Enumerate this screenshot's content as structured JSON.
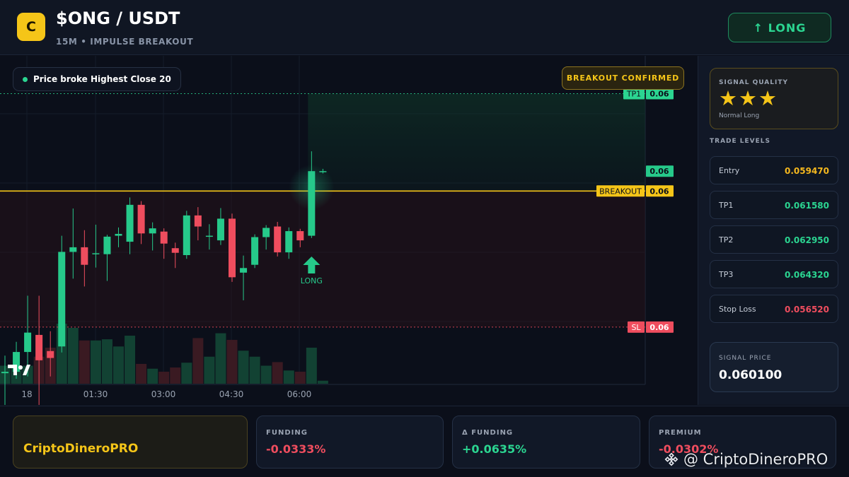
{
  "header": {
    "coin_letter": "C",
    "pair": "$ONG / USDT",
    "subtitle": "15M • IMPULSE BREAKOUT",
    "signal_button": "↑ LONG"
  },
  "chart": {
    "info_chip": "Price broke Highest Close 20",
    "breakout_tag": "BREAKOUT CONFIRMED",
    "entry_marker": "LONG",
    "time_labels": [
      "18",
      "01:30",
      "03:00",
      "04:30",
      "06:00"
    ],
    "level_tags": {
      "tp1": "TP1",
      "breakout": "BREAKOUT",
      "sl": "SL"
    },
    "price_tags": {
      "tp1": "0.06",
      "current": "0.06",
      "breakout": "0.06",
      "sl": "0.06"
    },
    "colors": {
      "up": "#26c98a",
      "down": "#ef4d5e",
      "breakout": "#f5c518",
      "tp": "#2bd591",
      "sl": "#ef4d5e"
    }
  },
  "chart_data": {
    "type": "candlestick",
    "title": "",
    "xlabel": "",
    "ylabel": "",
    "ylim": [
      0.0552,
      0.0624
    ],
    "levels": {
      "tp1": 0.06158,
      "breakout": 0.05947,
      "sl": 0.05652
    },
    "candles": [
      {
        "o": 0.05552,
        "h": 0.0559,
        "l": 0.0547,
        "c": 0.05555
      },
      {
        "o": 0.05555,
        "h": 0.0562,
        "l": 0.0554,
        "c": 0.05598
      },
      {
        "o": 0.05598,
        "h": 0.0572,
        "l": 0.05545,
        "c": 0.0564
      },
      {
        "o": 0.05635,
        "h": 0.0572,
        "l": 0.0548,
        "c": 0.0558
      },
      {
        "o": 0.056,
        "h": 0.05643,
        "l": 0.05545,
        "c": 0.05585
      },
      {
        "o": 0.0561,
        "h": 0.0585,
        "l": 0.05597,
        "c": 0.05815
      },
      {
        "o": 0.05815,
        "h": 0.05909,
        "l": 0.05757,
        "c": 0.05825
      },
      {
        "o": 0.05825,
        "h": 0.05862,
        "l": 0.0574,
        "c": 0.05787
      },
      {
        "o": 0.05812,
        "h": 0.05874,
        "l": 0.05781,
        "c": 0.05812
      },
      {
        "o": 0.0581,
        "h": 0.05852,
        "l": 0.05752,
        "c": 0.05848
      },
      {
        "o": 0.0585,
        "h": 0.05868,
        "l": 0.05825,
        "c": 0.05854
      },
      {
        "o": 0.05837,
        "h": 0.05933,
        "l": 0.0581,
        "c": 0.05917
      },
      {
        "o": 0.05917,
        "h": 0.05925,
        "l": 0.05832,
        "c": 0.05855
      },
      {
        "o": 0.05855,
        "h": 0.05879,
        "l": 0.05818,
        "c": 0.05866
      },
      {
        "o": 0.05859,
        "h": 0.05866,
        "l": 0.058,
        "c": 0.05833
      },
      {
        "o": 0.05823,
        "h": 0.05835,
        "l": 0.0578,
        "c": 0.05813
      },
      {
        "o": 0.05808,
        "h": 0.05904,
        "l": 0.058,
        "c": 0.05894
      },
      {
        "o": 0.05894,
        "h": 0.05912,
        "l": 0.0584,
        "c": 0.0587
      },
      {
        "o": 0.0585,
        "h": 0.05875,
        "l": 0.0582,
        "c": 0.0585
      },
      {
        "o": 0.0584,
        "h": 0.0591,
        "l": 0.0583,
        "c": 0.05887
      },
      {
        "o": 0.05887,
        "h": 0.05898,
        "l": 0.0575,
        "c": 0.0576
      },
      {
        "o": 0.0577,
        "h": 0.05807,
        "l": 0.0571,
        "c": 0.0578
      },
      {
        "o": 0.05787,
        "h": 0.05853,
        "l": 0.0578,
        "c": 0.05847
      },
      {
        "o": 0.05847,
        "h": 0.05873,
        "l": 0.0582,
        "c": 0.05867
      },
      {
        "o": 0.0587,
        "h": 0.0588,
        "l": 0.05805,
        "c": 0.05814
      },
      {
        "o": 0.05814,
        "h": 0.05868,
        "l": 0.058,
        "c": 0.0586
      },
      {
        "o": 0.0586,
        "h": 0.05865,
        "l": 0.05825,
        "c": 0.0584
      },
      {
        "o": 0.0585,
        "h": 0.06033,
        "l": 0.05845,
        "c": 0.0599
      },
      {
        "o": 0.0599,
        "h": 0.05995,
        "l": 0.05985,
        "c": 0.0599
      }
    ],
    "volume": [
      0.3,
      0.3,
      0.3,
      0.45,
      0.6,
      1.0,
      0.93,
      0.72,
      0.72,
      0.74,
      0.62,
      0.8,
      0.33,
      0.25,
      0.2,
      0.27,
      0.35,
      0.76,
      0.45,
      0.84,
      0.73,
      0.55,
      0.45,
      0.3,
      0.36,
      0.22,
      0.2,
      0.6,
      0.05
    ]
  },
  "sidebar": {
    "quality_label": "SIGNAL QUALITY",
    "stars": "★★★",
    "quality_sub": "Normal Long",
    "levels_title": "TRADE LEVELS",
    "levels": [
      {
        "name": "Entry",
        "value": "0.059470",
        "color": "#f5b81e"
      },
      {
        "name": "TP1",
        "value": "0.061580",
        "color": "#2bd591"
      },
      {
        "name": "TP2",
        "value": "0.062950",
        "color": "#2bd591"
      },
      {
        "name": "TP3",
        "value": "0.064320",
        "color": "#2bd591"
      },
      {
        "name": "Stop Loss",
        "value": "0.056520",
        "color": "#ef4d5e"
      }
    ],
    "signal_price_label": "SIGNAL PRICE",
    "signal_price": "0.060100"
  },
  "footer": {
    "brand": "CriptoDineroPRO",
    "stats": [
      {
        "label": "FUNDING",
        "value": "-0.0333%",
        "color": "#ef4d5e"
      },
      {
        "label": "Δ FUNDING",
        "value": "+0.0635%",
        "color": "#2bd591"
      },
      {
        "label": "PREMIUM",
        "value": "-0.0302%",
        "color": "#ef4d5e"
      }
    ],
    "watermark": "@ CriptoDineroPRO"
  }
}
